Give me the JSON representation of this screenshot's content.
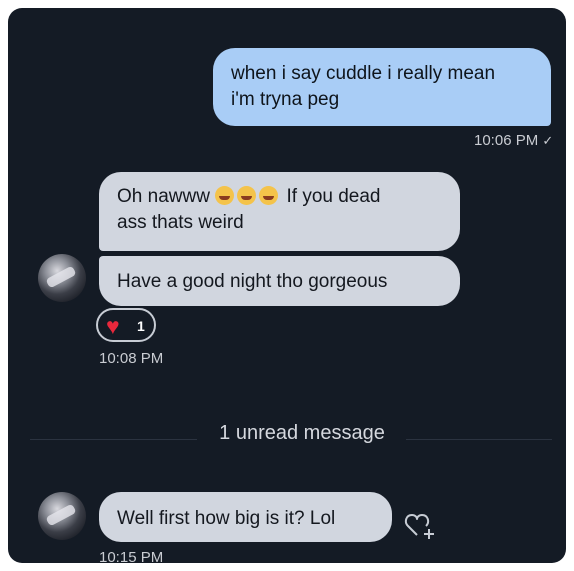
{
  "messages": {
    "outgoing": {
      "text_line1": "when i say cuddle i really mean",
      "text_line2": "i'm tryna peg",
      "time": "10:06 PM",
      "status_icon": "check-icon"
    },
    "incoming_1": {
      "text_part1": "Oh nawww",
      "text_part2": "If you dead",
      "text_line2": "ass thats weird",
      "emojis": [
        "laughing-emoji",
        "crying-emoji",
        "crying-emoji"
      ]
    },
    "incoming_2": {
      "text": "Have a good night tho gorgeous",
      "reaction_icon": "heart-icon",
      "reaction_count": "1",
      "time": "10:08 PM"
    },
    "unread_divider": {
      "text": "1 unread message"
    },
    "incoming_3": {
      "text": "Well first how big is it? Lol",
      "time": "10:15 PM",
      "action_icon": "add-reaction-heart-icon"
    }
  },
  "colors": {
    "background": "#141b25",
    "outgoing_bubble": "#a9cdf6",
    "incoming_bubble": "#d1d6df",
    "heart": "#e8283c"
  }
}
